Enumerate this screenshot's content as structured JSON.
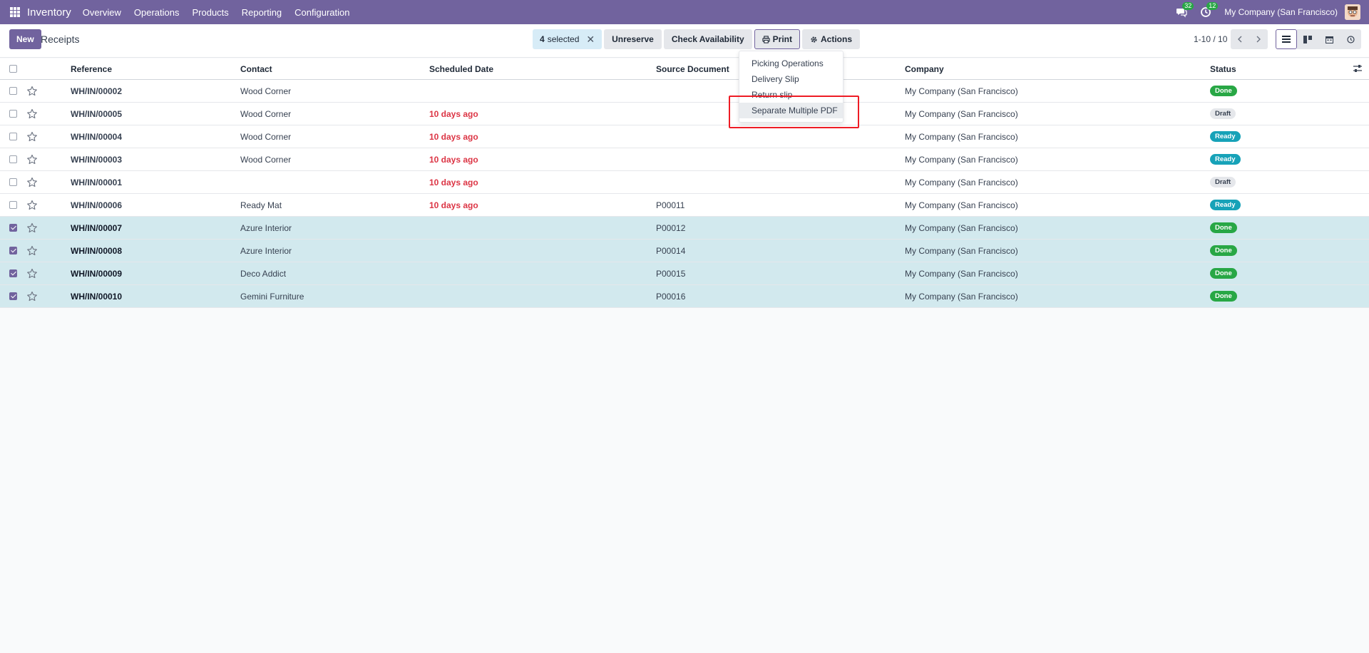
{
  "navbar": {
    "brand": "Inventory",
    "menu": [
      "Overview",
      "Operations",
      "Products",
      "Reporting",
      "Configuration"
    ],
    "messages_count": "32",
    "activities_count": "12",
    "company": "My Company (San Francisco)"
  },
  "control_panel": {
    "new_label": "New",
    "breadcrumb": "Receipts",
    "selected_count": "4",
    "selected_label": "selected",
    "unreserve_label": "Unreserve",
    "check_availability_label": "Check Availability",
    "print_label": "Print",
    "actions_label": "Actions",
    "pager": "1-10 / 10"
  },
  "table": {
    "columns": {
      "reference": "Reference",
      "contact": "Contact",
      "scheduled_date": "Scheduled Date",
      "source_document": "Source Document",
      "company": "Company",
      "status": "Status"
    },
    "rows": [
      {
        "reference": "WH/IN/00002",
        "contact": "Wood Corner",
        "scheduled_date": "",
        "source": "",
        "company": "My Company (San Francisco)",
        "status": "Done",
        "selected": false
      },
      {
        "reference": "WH/IN/00005",
        "contact": "Wood Corner",
        "scheduled_date": "10 days ago",
        "source": "",
        "company": "My Company (San Francisco)",
        "status": "Draft",
        "selected": false
      },
      {
        "reference": "WH/IN/00004",
        "contact": "Wood Corner",
        "scheduled_date": "10 days ago",
        "source": "",
        "company": "My Company (San Francisco)",
        "status": "Ready",
        "selected": false
      },
      {
        "reference": "WH/IN/00003",
        "contact": "Wood Corner",
        "scheduled_date": "10 days ago",
        "source": "",
        "company": "My Company (San Francisco)",
        "status": "Ready",
        "selected": false
      },
      {
        "reference": "WH/IN/00001",
        "contact": "",
        "scheduled_date": "10 days ago",
        "source": "",
        "company": "My Company (San Francisco)",
        "status": "Draft",
        "selected": false
      },
      {
        "reference": "WH/IN/00006",
        "contact": "Ready Mat",
        "scheduled_date": "10 days ago",
        "source": "P00011",
        "company": "My Company (San Francisco)",
        "status": "Ready",
        "selected": false
      },
      {
        "reference": "WH/IN/00007",
        "contact": "Azure Interior",
        "scheduled_date": "",
        "source": "P00012",
        "company": "My Company (San Francisco)",
        "status": "Done",
        "selected": true
      },
      {
        "reference": "WH/IN/00008",
        "contact": "Azure Interior",
        "scheduled_date": "",
        "source": "P00014",
        "company": "My Company (San Francisco)",
        "status": "Done",
        "selected": true
      },
      {
        "reference": "WH/IN/00009",
        "contact": "Deco Addict",
        "scheduled_date": "",
        "source": "P00015",
        "company": "My Company (San Francisco)",
        "status": "Done",
        "selected": true
      },
      {
        "reference": "WH/IN/00010",
        "contact": "Gemini Furniture",
        "scheduled_date": "",
        "source": "P00016",
        "company": "My Company (San Francisco)",
        "status": "Done",
        "selected": true
      }
    ]
  },
  "print_menu": {
    "items": [
      "Picking Operations",
      "Delivery Slip",
      "Return slip",
      "Separate Multiple PDF"
    ]
  },
  "colors": {
    "brand": "#71639e",
    "done": "#28a745",
    "ready": "#17a2b8",
    "late": "#dc3545",
    "selected_row": "#d2e9ee",
    "highlight": "#ee1c25"
  }
}
